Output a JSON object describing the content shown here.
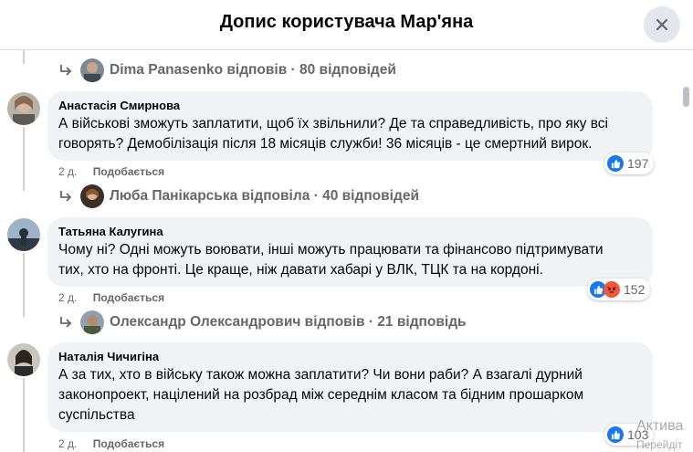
{
  "header": {
    "title": "Допис користувача Мар'яна"
  },
  "threads": [
    {
      "reply": {
        "text": "Dima Panasenko відповів · 80 відповідей"
      }
    },
    {
      "author": "Анастасія Смирнова",
      "lines": [
        "А військові зможуть заплатити, щоб їх звільнили? Де та справедливість, про яку всі",
        "говорять? Демобілізація після 18 місяців служби! 36 місяців - це смертний вирок."
      ],
      "time": "2 д.",
      "like": "Подобається",
      "count": "197",
      "reply": {
        "text": "Люба Панікарська відповіла · 40 відповідей"
      }
    },
    {
      "author": "Татьяна Калугина",
      "lines": [
        "Чому ні? Одні можуть воювати, інші можуть працювати та фінансово підтримувати",
        "тих, хто на фронті. Це краще, ніж давати хабарі у ВЛК, ТЦК та на кордоні."
      ],
      "time": "2 д.",
      "like": "Подобається",
      "count": "152",
      "reply": {
        "text": "Олександр Олександрович відповів · 21 відповідь"
      }
    },
    {
      "author": "Наталія Чичигіна",
      "lines": [
        "А за тих, хто в війську також можна заплатити? Чи вони раби? А взагалі дурний",
        "законопроект, націлений на розбрад між середнім класом та бідним прошарком",
        "суспільства"
      ],
      "time": "2 д.",
      "like": "Подобається",
      "count": "103"
    }
  ],
  "watermark": {
    "line1": "Актива",
    "line2": "Перейдіт"
  },
  "colors": {
    "like_blue": "#1877f2",
    "angry": "#f0573b",
    "bubble": "#f0f2f5",
    "meta": "#65676b"
  }
}
